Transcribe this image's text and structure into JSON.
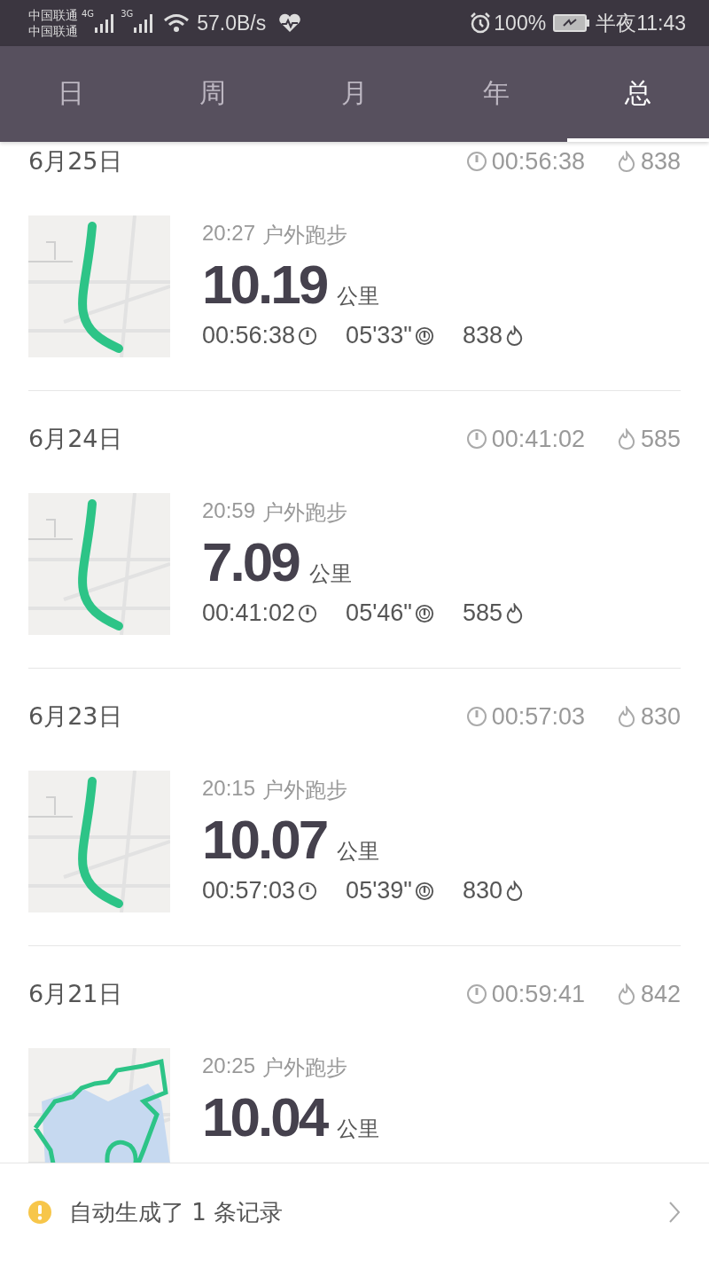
{
  "status_bar": {
    "carriers": [
      "中国联通",
      "中国联通"
    ],
    "networks": [
      "4G",
      "3G"
    ],
    "speed": "57.0B/s",
    "battery": "100%",
    "time": "半夜11:43"
  },
  "tabs": [
    {
      "label": "日",
      "selected": false
    },
    {
      "label": "周",
      "selected": false
    },
    {
      "label": "月",
      "selected": false
    },
    {
      "label": "年",
      "selected": false
    },
    {
      "label": "总",
      "selected": true
    }
  ],
  "days": [
    {
      "date": "6月25日",
      "total_duration": "00:56:38",
      "total_calories": "838",
      "records": [
        {
          "time": "20:27",
          "activity": "户外跑步",
          "distance": "10.19",
          "unit": "公里",
          "duration": "00:56:38",
          "pace": "05'33\"",
          "calories": "838"
        }
      ]
    },
    {
      "date": "6月24日",
      "total_duration": "00:41:02",
      "total_calories": "585",
      "records": [
        {
          "time": "20:59",
          "activity": "户外跑步",
          "distance": "7.09",
          "unit": "公里",
          "duration": "00:41:02",
          "pace": "05'46\"",
          "calories": "585"
        }
      ]
    },
    {
      "date": "6月23日",
      "total_duration": "00:57:03",
      "total_calories": "830",
      "records": [
        {
          "time": "20:15",
          "activity": "户外跑步",
          "distance": "10.07",
          "unit": "公里",
          "duration": "00:57:03",
          "pace": "05'39\"",
          "calories": "830"
        }
      ]
    },
    {
      "date": "6月21日",
      "total_duration": "00:59:41",
      "total_calories": "842",
      "records": [
        {
          "time": "20:25",
          "activity": "户外跑步",
          "distance": "10.04",
          "unit": "公里"
        }
      ]
    }
  ],
  "notice": {
    "text": "自动生成了 1 条记录"
  }
}
